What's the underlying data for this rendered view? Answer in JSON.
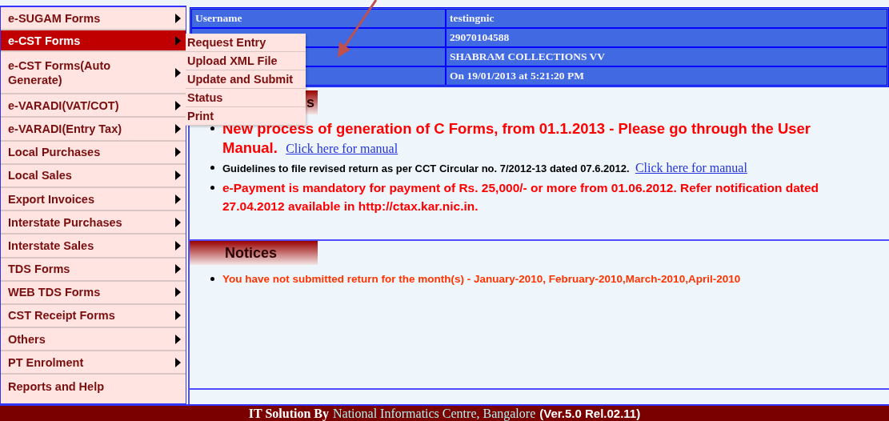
{
  "sidebar": {
    "items": [
      {
        "label": "e-SUGAM Forms",
        "submenu": true,
        "selected": false
      },
      {
        "label": "e-CST Forms",
        "submenu": true,
        "selected": true
      },
      {
        "label": "e-CST Forms(Auto Generate)",
        "submenu": true,
        "selected": false
      },
      {
        "label": "e-VARADI(VAT/COT)",
        "submenu": true,
        "selected": false
      },
      {
        "label": "e-VARADI(Entry Tax)",
        "submenu": true,
        "selected": false
      },
      {
        "label": "Local Purchases",
        "submenu": true,
        "selected": false
      },
      {
        "label": "Local Sales",
        "submenu": true,
        "selected": false
      },
      {
        "label": "Export Invoices",
        "submenu": true,
        "selected": false
      },
      {
        "label": "Interstate Purchases",
        "submenu": true,
        "selected": false
      },
      {
        "label": "Interstate Sales",
        "submenu": true,
        "selected": false
      },
      {
        "label": "TDS Forms",
        "submenu": true,
        "selected": false
      },
      {
        "label": "WEB TDS Forms",
        "submenu": true,
        "selected": false
      },
      {
        "label": "CST Receipt Forms",
        "submenu": true,
        "selected": false
      },
      {
        "label": "Others",
        "submenu": true,
        "selected": false
      },
      {
        "label": "PT Enrolment",
        "submenu": true,
        "selected": false
      },
      {
        "label": "Reports and Help",
        "submenu": false,
        "selected": false
      }
    ]
  },
  "submenu": {
    "items": [
      "Request Entry",
      "Upload XML File",
      "Update and Submit",
      "Status",
      "Print"
    ]
  },
  "user_table": {
    "rows": [
      {
        "label": "Username",
        "value": "testingnic"
      },
      {
        "value": "29070104588"
      },
      {
        "value": "SHABRAM COLLECTIONS VV"
      },
      {
        "value": "On 19/01/2013 at 5:21:20 PM"
      }
    ]
  },
  "news": {
    "heading": "s",
    "items": [
      {
        "kind": "headline",
        "text": "New process of generation of C Forms, from 01.1.2013 - Please go through the User Manual.",
        "link": "Click here for manual"
      },
      {
        "kind": "note",
        "text": "Guidelines to file revised return as per CCT Circular no. 7/2012-13 dated 07.6.2012.",
        "link": "Click here for manual"
      },
      {
        "kind": "alert",
        "text": "e-Payment is mandatory for payment of Rs. 25,000/- or more from 01.06.2012. Refer notification dated 27.04.2012 available in http://ctax.kar.nic.in."
      }
    ]
  },
  "notices": {
    "heading": "Notices",
    "items": [
      {
        "text": "You have not submitted return for the month(s) - January-2010, February-2010,March-2010,April-2010"
      }
    ]
  },
  "footer": {
    "prefix": "IT Solution By",
    "link": "National Informatics Centre, Bangalore",
    "version": "(Ver.5.0 Rel.02.11)"
  }
}
